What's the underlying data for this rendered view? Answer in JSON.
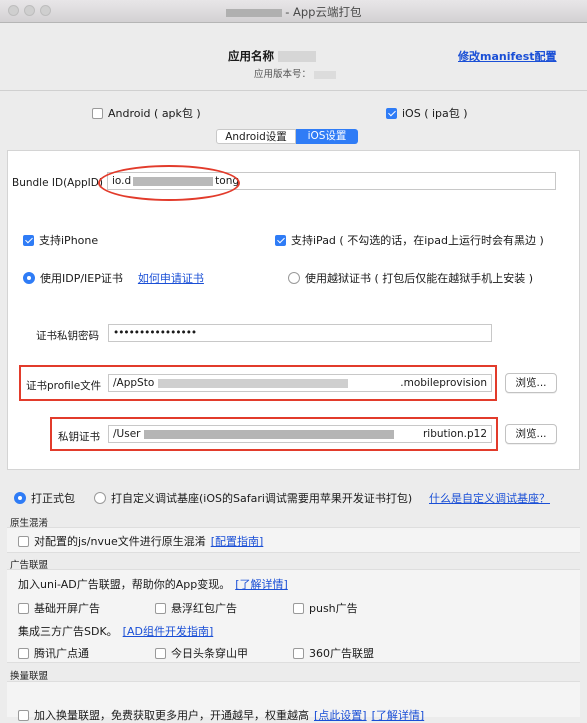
{
  "window": {
    "title": "- App云端打包",
    "redacted_title_prefix": "█████"
  },
  "header": {
    "app_name_label": "应用名称",
    "app_version_label": "应用版本号：",
    "modify_manifest_link": "修改manifest配置"
  },
  "platforms": {
    "android": {
      "label": "Android ( apk包 )",
      "checked": false
    },
    "ios": {
      "label": "iOS ( ipa包 )",
      "checked": true
    }
  },
  "tabs": [
    {
      "label": "Android设置",
      "active": false
    },
    {
      "label": "iOS设置",
      "active": true
    }
  ],
  "ios_settings": {
    "bundle_id_label": "Bundle ID(AppID)",
    "bundle_id_value_start": "io.d",
    "bundle_id_value_end": "tong",
    "support_iphone": {
      "label": "支持iPhone",
      "checked": true
    },
    "support_ipad": {
      "label": "支持iPad ( 不勾选的话，在ipad上运行时会有黑边 )",
      "checked": true
    },
    "cert_type_idp": {
      "label": "使用IDP/IEP证书",
      "checked": true
    },
    "apply_cert_link": "如何申请证书",
    "cert_type_jailbreak": {
      "label": "使用越狱证书 ( 打包后仅能在越狱手机上安装 )",
      "checked": false
    },
    "cert_password_label": "证书私钥密码",
    "cert_password_value": "••••••••••••••••",
    "profile_label": "证书profile文件",
    "profile_value_start": "/AppSto",
    "profile_value_end": ".mobileprovision",
    "private_key_label": "私钥证书",
    "private_key_value_start": "/User",
    "private_key_value_end": "ribution.p12",
    "browse_label": "浏览..."
  },
  "build_type": {
    "formal": {
      "label": "打正式包",
      "checked": true
    },
    "custom_base": {
      "label": "打自定义调试基座(iOS的Safari调试需要用苹果开发证书打包)",
      "checked": false
    },
    "what_is_custom_link": "什么是自定义调试基座？"
  },
  "native_obfuscation": {
    "section_label": "原生混淆",
    "option_label": "对配置的js/nvue文件进行原生混淆",
    "guide_link": "[配置指南]",
    "checked": false
  },
  "ad_alliance": {
    "section_label": "广告联盟",
    "intro_text": "加入uni-AD广告联盟，帮助你的App变现。",
    "learn_more_link": "[了解详情]",
    "options_row1": [
      "基础开屏广告",
      "悬浮红包广告",
      "push广告"
    ],
    "third_party_text": "集成三方广告SDK。",
    "third_party_link": "[AD组件开发指南]",
    "options_row2": [
      "腾讯广点通",
      "今日头条穿山甲",
      "360广告联盟"
    ]
  },
  "exchange_alliance": {
    "section_label": "换量联盟",
    "option_text": "加入换量联盟，免费获取更多用户，开通越早，权重越高",
    "settings_link": "[点此设置]",
    "learn_more_link": "[了解详情]"
  },
  "colors": {
    "accent": "#2f7cf6",
    "link": "#1a4fd6",
    "annotation_red": "#e23b2b"
  }
}
